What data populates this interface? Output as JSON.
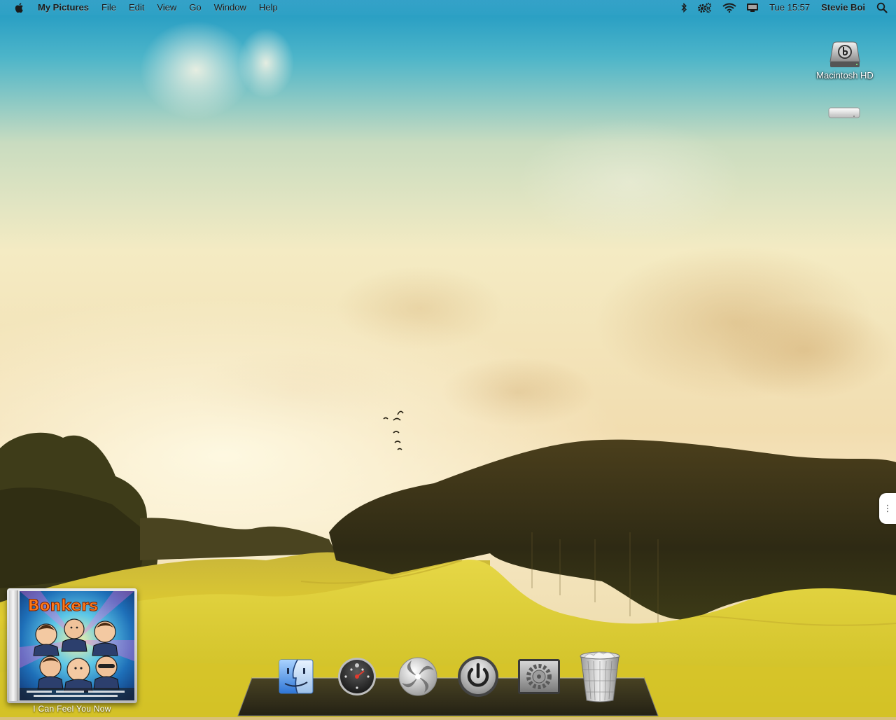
{
  "menubar": {
    "apple_icon": "apple-logo-icon",
    "app_name": "My Pictures",
    "menus": [
      "File",
      "Edit",
      "View",
      "Go",
      "Window",
      "Help"
    ],
    "status_icons": [
      "bluetooth-icon",
      "gear-icon",
      "wifi-icon",
      "display-icon"
    ],
    "clock": "Tue 15:57",
    "user": "Stevie Boi",
    "search_icon": "spotlight-search-icon"
  },
  "desktop": {
    "icons": [
      {
        "label": "Macintosh HD",
        "icon": "hard-drive-icon"
      },
      {
        "label": "",
        "icon": "mac-mini-icon"
      }
    ]
  },
  "widget": {
    "album_art_title": "Bonkers",
    "track_title": "I Can Feel You Now"
  },
  "dock": {
    "items": [
      {
        "name": "finder",
        "icon": "finder-icon"
      },
      {
        "name": "dashboard",
        "icon": "dashboard-icon"
      },
      {
        "name": "spiral-app",
        "icon": "spiral-icon"
      },
      {
        "name": "power",
        "icon": "power-icon"
      },
      {
        "name": "system-preferences",
        "icon": "system-preferences-icon"
      },
      {
        "name": "trash",
        "icon": "trash-icon"
      }
    ]
  },
  "colors": {
    "sky_top": "#1e9bc6",
    "sky_haze": "#f3e9c0",
    "hill_grass": "#e9d437",
    "forest": "#3a3a18",
    "menu_text": "#1b1b1b"
  }
}
